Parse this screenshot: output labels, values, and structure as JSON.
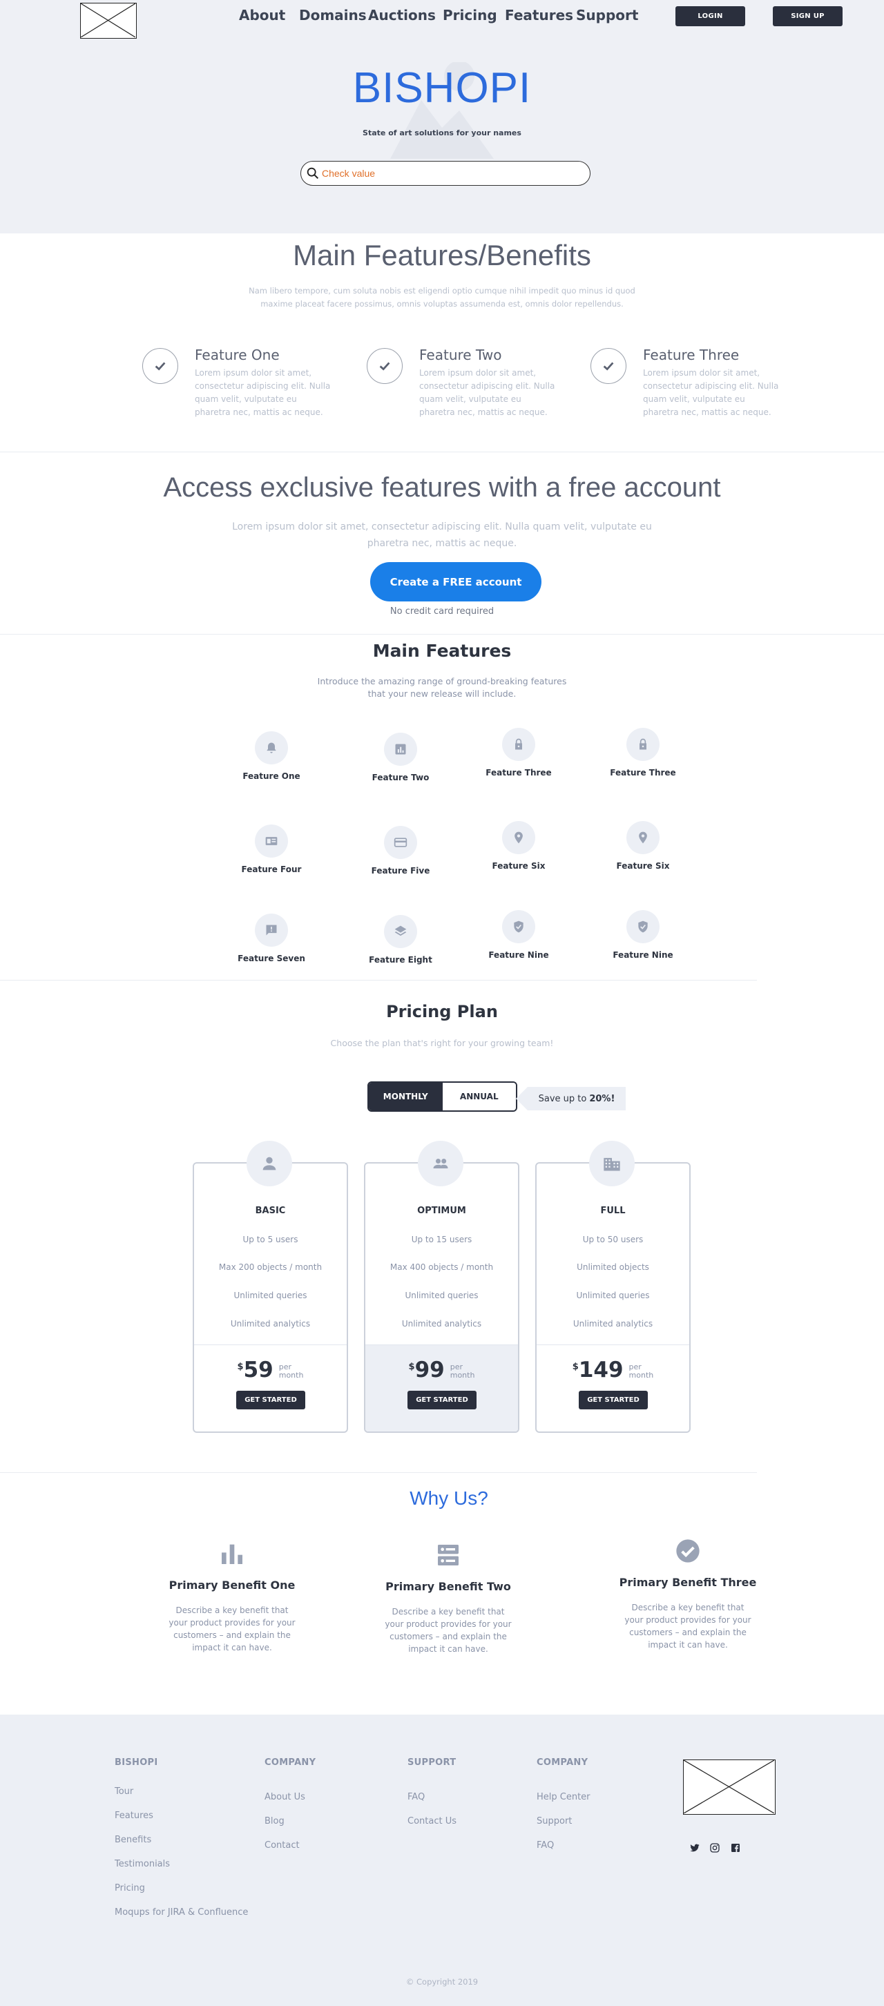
{
  "header": {
    "nav": [
      "About",
      "Domains",
      "Auctions",
      "Pricing",
      "Features",
      "Support"
    ],
    "login_label": "LOGIN",
    "signup_label": "SIGN UP"
  },
  "hero": {
    "brand": "BISHOPI",
    "tagline": "State of art solutions for your names",
    "search_placeholder": "Check value"
  },
  "benefits": {
    "title": "Main Features/Benefits",
    "subtitle_lines": [
      "Nam libero tempore, cum soluta nobis est eligendi optio cumque nihil impedit quo minus id quod",
      "maxime placeat facere possimus, omnis voluptas assumenda est, omnis dolor repellendus."
    ],
    "items": [
      {
        "title": "Feature One",
        "text": "Lorem ipsum dolor sit amet, consectetur adipiscing elit. Nulla quam velit, vulputate eu pharetra nec, mattis ac neque."
      },
      {
        "title": "Feature Two",
        "text": "Lorem ipsum dolor sit amet, consectetur adipiscing elit. Nulla quam velit, vulputate eu pharetra nec, mattis ac neque."
      },
      {
        "title": "Feature Three",
        "text": "Lorem ipsum dolor sit amet, consectetur adipiscing elit. Nulla quam velit, vulputate eu pharetra nec, mattis ac neque."
      }
    ]
  },
  "cta": {
    "title": "Access exclusive features with a free account",
    "text_lines": [
      "Lorem ipsum dolor sit amet, consectetur adipiscing elit. Nulla quam velit, vulputate eu",
      "pharetra nec, mattis ac neque."
    ],
    "button": "Create a FREE account",
    "note": "No credit card required"
  },
  "main_features": {
    "title": "Main Features",
    "subtitle_lines": [
      "Introduce the amazing range of ground-breaking features",
      "that your new release will include."
    ],
    "items": [
      {
        "label": "Feature One",
        "icon": "bell-icon"
      },
      {
        "label": "Feature Two",
        "icon": "bar-chart-icon"
      },
      {
        "label": "Feature Three",
        "icon": "lock-icon"
      },
      {
        "label": "Feature Three",
        "icon": "lock-icon"
      },
      {
        "label": "Feature Four",
        "icon": "card-layout-icon"
      },
      {
        "label": "Feature Five",
        "icon": "credit-card-icon"
      },
      {
        "label": "Feature Six",
        "icon": "map-pin-icon"
      },
      {
        "label": "Feature Six",
        "icon": "map-pin-icon"
      },
      {
        "label": "Feature Seven",
        "icon": "feedback-icon"
      },
      {
        "label": "Feature Eight",
        "icon": "layers-icon"
      },
      {
        "label": "Feature Nine",
        "icon": "verified-shield-icon"
      },
      {
        "label": "Feature Nine",
        "icon": "verified-shield-icon"
      }
    ]
  },
  "pricing": {
    "title": "Pricing Plan",
    "subtitle": "Choose the plan that's right for your growing team!",
    "toggle": {
      "monthly": "MONTHLY",
      "annual": "ANNUAL",
      "selected": "MONTHLY"
    },
    "save_prefix": "Save up to",
    "save_value": "20%!",
    "plans": [
      {
        "name": "BASIC",
        "icon": "person-icon",
        "features": [
          "Up to 5 users",
          "Max 200 objects / month",
          "Unlimited queries",
          "Unlimited analytics"
        ],
        "currency": "$",
        "price": "59",
        "per_1": "per",
        "per_2": "month",
        "button": "GET STARTED"
      },
      {
        "name": "OPTIMUM",
        "icon": "group-icon",
        "features": [
          "Up to 15 users",
          "Max 400 objects / month",
          "Unlimited queries",
          "Unlimited analytics"
        ],
        "currency": "$",
        "price": "99",
        "per_1": "per",
        "per_2": "month",
        "button": "GET STARTED"
      },
      {
        "name": "FULL",
        "icon": "building-icon",
        "features": [
          "Up to 50 users",
          "Unlimited objects",
          "Unlimited queries",
          "Unlimited analytics"
        ],
        "currency": "$",
        "price": "149",
        "per_1": "per",
        "per_2": "month",
        "button": "GET STARTED"
      }
    ]
  },
  "why": {
    "title": "Why Us?",
    "items": [
      {
        "title": "Primary Benefit One",
        "icon": "bar-chart-icon",
        "text": "Describe a key benefit that your product provides for your customers – and explain the impact it can have."
      },
      {
        "title": "Primary Benefit Two",
        "icon": "server-icon",
        "text": "Describe a key benefit that your product provides for your customers – and explain the impact it can have."
      },
      {
        "title": "Primary Benefit Three",
        "icon": "check-circle-icon",
        "text": "Describe a key benefit that your product provides for your customers – and explain the impact it can have."
      }
    ]
  },
  "footer": {
    "columns": [
      {
        "title": "BISHOPI",
        "links": [
          "Tour",
          "Features",
          "Benefits",
          "Testimonials",
          "Pricing",
          "Moqups for JIRA & Confluence"
        ]
      },
      {
        "title": "COMPANY",
        "links": [
          "About Us",
          "Blog",
          "Contact"
        ]
      },
      {
        "title": "SUPPORT",
        "links": [
          "FAQ",
          "Contact Us"
        ]
      },
      {
        "title": "COMPANY",
        "links": [
          "Help Center",
          "Support",
          "FAQ"
        ]
      }
    ],
    "social": [
      "twitter-icon",
      "instagram-icon",
      "facebook-icon"
    ],
    "copyright": "© Copyright 2019"
  },
  "colors": {
    "accent_blue": "#2d6bdc",
    "cta_blue": "#1a7fe8",
    "dark": "#2a2f3d",
    "hero_bg": "#eef0f5",
    "search_text": "#e0702a"
  }
}
